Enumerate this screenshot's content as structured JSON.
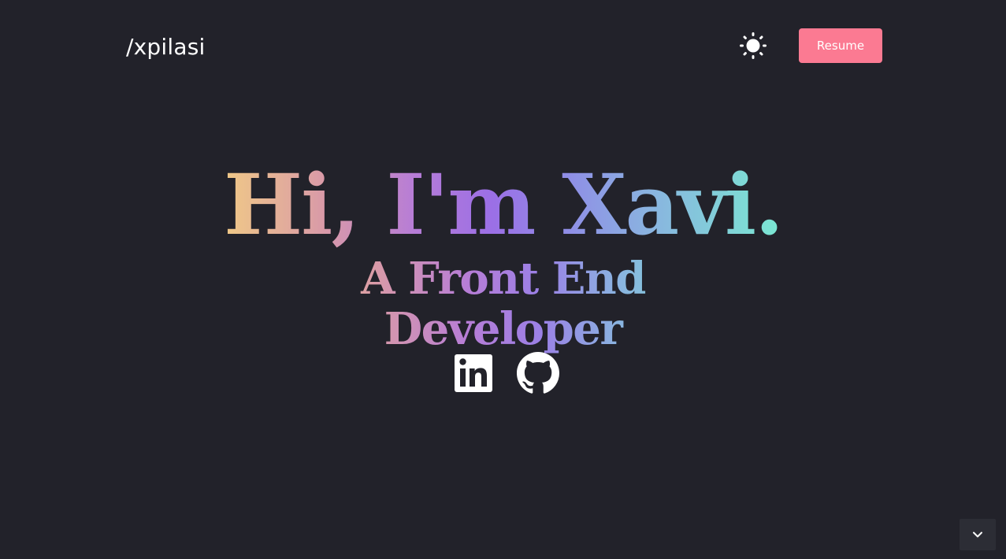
{
  "header": {
    "logo_text": "/xpilasi",
    "theme_toggle_icon": "sun-icon",
    "resume_label": "Resume"
  },
  "hero": {
    "headline": "Hi, I'm Xavi.",
    "subheadline": "A Front End Developer"
  },
  "socials": [
    {
      "icon": "linkedin-icon"
    },
    {
      "icon": "github-icon"
    }
  ],
  "scroll_button": {
    "icon": "chevron-down-icon"
  },
  "colors": {
    "background": "#22222a",
    "accent": "#fb7a92",
    "gradient_start": "#f0c987",
    "gradient_mid": "#9b6fe6",
    "gradient_end": "#7ae8d2"
  }
}
